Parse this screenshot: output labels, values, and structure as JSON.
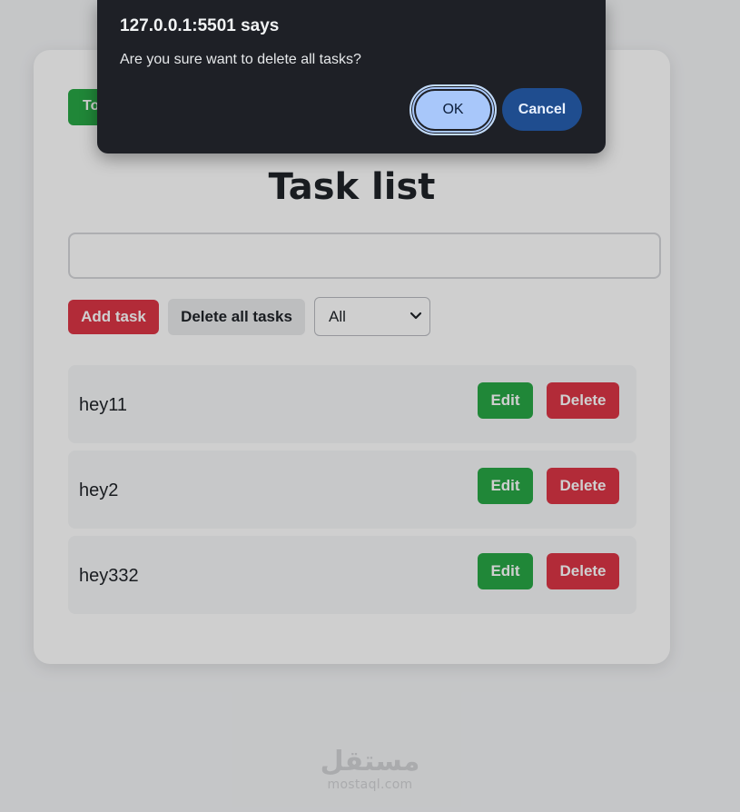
{
  "app": {
    "toggle_button_label": "To",
    "title": "Task list",
    "input": {
      "value": "",
      "placeholder": ""
    },
    "add_button_label": "Add task",
    "delete_all_button_label": "Delete all tasks",
    "filter": {
      "selected": "All"
    },
    "tasks": [
      {
        "text": "hey11",
        "edit_label": "Edit",
        "delete_label": "Delete"
      },
      {
        "text": "hey2",
        "edit_label": "Edit",
        "delete_label": "Delete"
      },
      {
        "text": "hey332",
        "edit_label": "Edit",
        "delete_label": "Delete"
      }
    ]
  },
  "watermark": {
    "arabic": "مستقل",
    "latin": "mostaql.com"
  },
  "dialog": {
    "title": "127.0.0.1:5501 says",
    "message": "Are you sure want to delete all tasks?",
    "ok_label": "OK",
    "cancel_label": "Cancel"
  },
  "colors": {
    "primary_green": "#28a745",
    "danger_red": "#dc3545",
    "dialog_bg": "#1e2026",
    "ok_button": "#a8c7fa",
    "cancel_button": "#1f4d8f"
  },
  "icons": {
    "filter_dropdown": "chevron-down-icon"
  }
}
